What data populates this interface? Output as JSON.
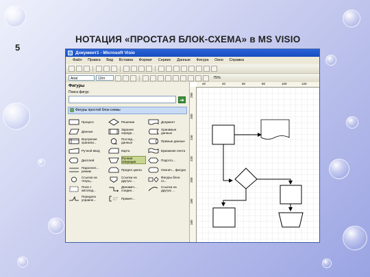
{
  "slide": {
    "number": "5",
    "title": "НОТАЦИЯ «ПРОСТАЯ БЛОК-СХЕМА» в MS VISIO"
  },
  "window": {
    "title": "Документ1 - Microsoft Visio"
  },
  "menu": [
    "Файл",
    "Правка",
    "Вид",
    "Вставка",
    "Формат",
    "Сервис",
    "Данные",
    "Фигура",
    "Окно",
    "Справка"
  ],
  "format_bar": {
    "font": "Arial",
    "size": "12пт",
    "zoom": "75%"
  },
  "shapes_pane": {
    "title": "Фигуры",
    "search_label": "Поиск фигур:",
    "search_value": "",
    "stencil": "Фигуры простой блок-схемы",
    "shapes": [
      {
        "label": "Процесс",
        "icon": "rect-icon"
      },
      {
        "label": "Решение",
        "icon": "diamond-icon"
      },
      {
        "label": "Документ",
        "icon": "document-icon"
      },
      {
        "label": "Данные",
        "icon": "parallelogram-icon"
      },
      {
        "label": "Заранее опреде...",
        "icon": "predefined-icon"
      },
      {
        "label": "Хранимые данные",
        "icon": "stored-data-icon"
      },
      {
        "label": "Внутренне хранили...",
        "icon": "internal-storage-icon"
      },
      {
        "label": "Послед... данные",
        "icon": "sequential-data-icon"
      },
      {
        "label": "Прямые данные",
        "icon": "direct-data-icon"
      },
      {
        "label": "Ручной ввод",
        "icon": "manual-input-icon"
      },
      {
        "label": "Карта",
        "icon": "card-icon"
      },
      {
        "label": "Бумажная лента",
        "icon": "paper-tape-icon"
      },
      {
        "label": "Дисплей",
        "icon": "display-icon"
      },
      {
        "label": "Ручная операция",
        "icon": "manual-operation-icon"
      },
      {
        "label": "Подгото...",
        "icon": "preparation-icon"
      },
      {
        "label": "Параллел... режим",
        "icon": "parallel-mode-icon"
      },
      {
        "label": "Предел цикла",
        "icon": "loop-limit-icon"
      },
      {
        "label": "Оконеч... фигура",
        "icon": "terminator-icon"
      },
      {
        "label": "Ссылка на текущ...",
        "icon": "on-page-reference-icon"
      },
      {
        "label": "Ссылка на другую ...",
        "icon": "off-page-reference-icon"
      },
      {
        "label": "Фигуры блок-сх...",
        "icon": "flowchart-shapes-icon"
      },
      {
        "label": "Поле с автопод...",
        "icon": "auto-height-box-icon"
      },
      {
        "label": "Динамич... соедин...",
        "icon": "dynamic-connector-icon"
      },
      {
        "label": "Ссылка на другую ...",
        "icon": "line-curve-connector-icon"
      },
      {
        "label": "Передача управле...",
        "icon": "control-transfer-icon"
      },
      {
        "label": "Примеч...",
        "icon": "annotation-icon"
      }
    ]
  },
  "rulers": {
    "top": [
      "20",
      "40",
      "60",
      "80",
      "100",
      "120"
    ],
    "left": [
      "280",
      "260",
      "240",
      "220",
      "200",
      "180",
      "160"
    ]
  },
  "diagram": {
    "shapes": [
      "process",
      "document",
      "decision",
      "process",
      "process",
      "manual-operation"
    ]
  }
}
